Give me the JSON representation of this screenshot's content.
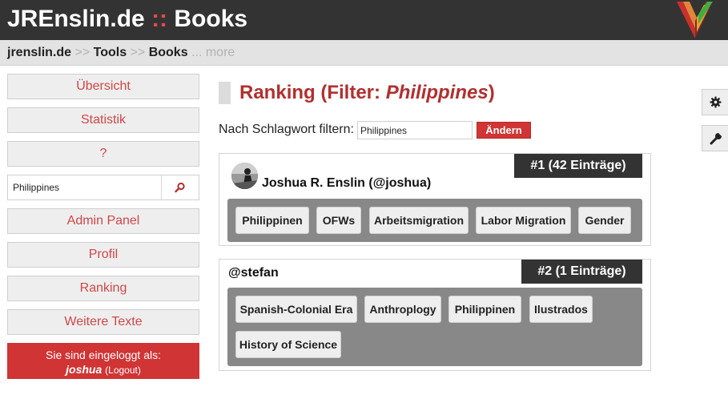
{
  "header": {
    "brand": "JREnslin.de",
    "separator": "::",
    "section": "Books",
    "colors": {
      "bar": "#333333",
      "accent": "#e04a4a"
    }
  },
  "breadcrumb": {
    "items": [
      "jrenslin.de",
      "Tools",
      "Books"
    ],
    "arrow": ">>",
    "more": "... more"
  },
  "sidebar": {
    "nav": [
      "Übersicht",
      "Statistik",
      "?"
    ],
    "search": {
      "value": "Philippines",
      "icon": "search-icon"
    },
    "nav2": [
      "Admin Panel",
      "Profil",
      "Ranking",
      "Weitere Texte"
    ],
    "login": {
      "prefix": "Sie sind eingeloggt als:",
      "username": "joshua",
      "logout": "(Logout)"
    }
  },
  "main": {
    "title_prefix": "Ranking (Filter:",
    "title_filter": "Philippines",
    "title_suffix": ")",
    "filter": {
      "label": "Nach Schlagwort filtern:",
      "value": "Philippines",
      "button": "Ändern"
    },
    "ranking": [
      {
        "rank": "#1 (42 Einträge)",
        "name": "Joshua R. Enslin (@joshua)",
        "has_avatar": true,
        "tags": [
          "Philippinen",
          "OFWs",
          "Arbeitsmigration",
          "Labor Migration",
          "Gender"
        ]
      },
      {
        "rank": "#2 (1 Einträge)",
        "name": "@stefan",
        "has_avatar": false,
        "tags": [
          "Spanish-Colonial Era",
          "Anthroplogy",
          "Philippinen",
          "Ilustrados",
          "History of Science"
        ]
      }
    ]
  },
  "tools": [
    {
      "name": "gear-icon"
    },
    {
      "name": "wrench-icon"
    }
  ],
  "colors": {
    "brand_red": "#d03434",
    "title_red": "#b03030",
    "tag_panel": "#888888"
  }
}
